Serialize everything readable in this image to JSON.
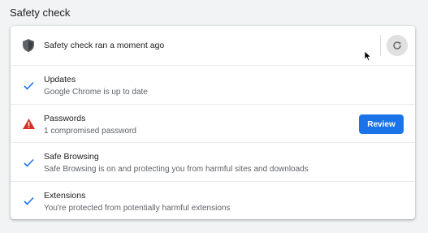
{
  "section": {
    "title": "Safety check"
  },
  "header_row": {
    "status_text": "Safety check ran a moment ago",
    "status_icon": "shield-icon",
    "refresh_icon": "refresh-icon"
  },
  "items": [
    {
      "title": "Updates",
      "subtitle": "Google Chrome is up to date",
      "icon": "check-icon",
      "status": "ok"
    },
    {
      "title": "Passwords",
      "subtitle": "1 compromised password",
      "icon": "warning-icon",
      "status": "warning",
      "action_label": "Review"
    },
    {
      "title": "Safe Browsing",
      "subtitle": "Safe Browsing is on and protecting you from harmful sites and downloads",
      "icon": "check-icon",
      "status": "ok"
    },
    {
      "title": "Extensions",
      "subtitle": "You're protected from potentially harmful extensions",
      "icon": "check-icon",
      "status": "ok"
    }
  ],
  "colors": {
    "accent": "#1a73e8",
    "warning": "#d93025",
    "check": "#1a73e8",
    "shield": "#5f6368"
  }
}
